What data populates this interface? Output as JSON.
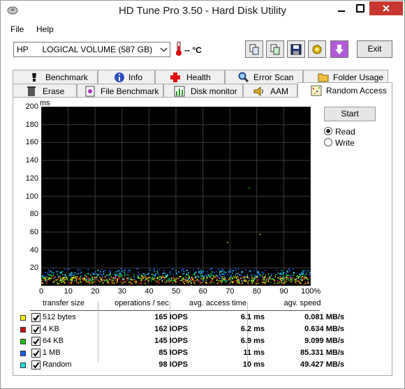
{
  "window": {
    "title": "HD Tune Pro 3.50 - Hard Disk Utility"
  },
  "menu": {
    "file": "File",
    "help": "Help"
  },
  "toolbar": {
    "drive": "HP      LOGICAL VOLUME (587 GB)",
    "temperature": "-- °C",
    "exit_label": "Exit",
    "icons": [
      "copy-icon",
      "copy-screenshot-icon",
      "save-icon",
      "options-icon",
      "down-arrow-icon"
    ]
  },
  "tabs": {
    "row1": [
      "Benchmark",
      "Info",
      "Health",
      "Error Scan",
      "Folder Usage"
    ],
    "row2": [
      "Erase",
      "File Benchmark",
      "Disk monitor",
      "AAM",
      "Random Access"
    ],
    "active": "Random Access"
  },
  "controls": {
    "start_label": "Start",
    "read_label": "Read",
    "write_label": "Write",
    "selected": "Read"
  },
  "chart_data": {
    "type": "scatter",
    "ylabel": "ms",
    "ylim": [
      0,
      200
    ],
    "xlim": [
      0,
      100
    ],
    "yticks": [
      "200",
      "180",
      "160",
      "140",
      "120",
      "100",
      "80",
      "60",
      "40",
      "20"
    ],
    "xticks": [
      "0",
      "10",
      "20",
      "30",
      "40",
      "50",
      "60",
      "70",
      "80",
      "90",
      "100%"
    ],
    "grid": true,
    "series": [
      {
        "name": "512 bytes",
        "color": "#e8e800",
        "band": [
          3,
          11
        ]
      },
      {
        "name": "4 KB",
        "color": "#e02020",
        "band": [
          3,
          11
        ]
      },
      {
        "name": "64 KB",
        "color": "#20d020",
        "band": [
          4,
          14
        ]
      },
      {
        "name": "1 MB",
        "color": "#2060ff",
        "band": [
          8,
          20
        ]
      },
      {
        "name": "Random",
        "color": "#20e0e0",
        "band": [
          6,
          18
        ]
      }
    ]
  },
  "results": {
    "headers": [
      "transfer size",
      "operations / sec",
      "avg. access time",
      "agv. speed"
    ],
    "rows": [
      {
        "label": "512 bytes",
        "color": "#f0f000",
        "iops": "165 IOPS",
        "access": "6.1 ms",
        "speed": "0.081 MB/s"
      },
      {
        "label": "4 KB",
        "color": "#d01010",
        "iops": "162 IOPS",
        "access": "6.2 ms",
        "speed": "0.634 MB/s"
      },
      {
        "label": "64 KB",
        "color": "#10c010",
        "iops": "145 IOPS",
        "access": "6.9 ms",
        "speed": "9.099 MB/s"
      },
      {
        "label": "1 MB",
        "color": "#1060f0",
        "iops": "85 IOPS",
        "access": "11 ms",
        "speed": "85.331 MB/s"
      },
      {
        "label": "Random",
        "color": "#20e0e0",
        "iops": "98 IOPS",
        "access": "10 ms",
        "speed": "49.427 MB/s"
      }
    ]
  }
}
